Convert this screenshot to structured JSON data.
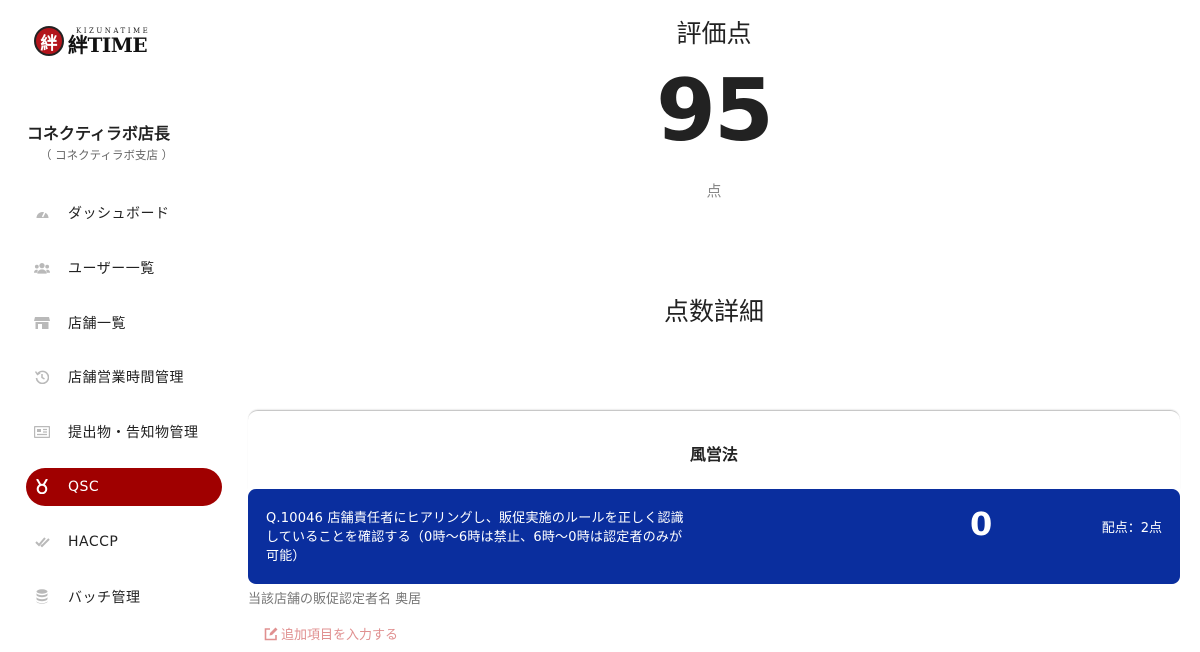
{
  "logo": {
    "mark": "絆",
    "small": "KIZUNATIME",
    "big": "絆TIME"
  },
  "user": {
    "name": "コネクティラボ店長",
    "store": "（ コネクティラボ支店 ）"
  },
  "nav": [
    {
      "label": "ダッシュボード",
      "icon": "dashboard-icon"
    },
    {
      "label": "ユーザー一覧",
      "icon": "users-icon"
    },
    {
      "label": "店舗一覧",
      "icon": "store-icon"
    },
    {
      "label": "店舗営業時間管理",
      "icon": "history-icon"
    },
    {
      "label": "提出物・告知物管理",
      "icon": "newspaper-icon"
    },
    {
      "label": "QSC",
      "icon": "medal-icon"
    },
    {
      "label": "HACCP",
      "icon": "check-double-icon"
    },
    {
      "label": "バッチ管理",
      "icon": "database-icon"
    }
  ],
  "main": {
    "score_title": "評価点",
    "score_value": "95",
    "score_unit": "点",
    "detail_title": "点数詳細",
    "section_title": "風営法",
    "question": {
      "text": "Q.10046 店舗責任者にヒアリングし、販促実施のルールを正しく認識していることを確認する（0時〜6時は禁止、6時〜0時は認定者のみが可能）",
      "score": "0",
      "points": "配点：2点"
    },
    "note": "当該店舗の販促認定者名 奥居",
    "add_link": "追加項目を入力する"
  },
  "colors": {
    "accent": "#a00000",
    "question_bg": "#0a2e9e",
    "link": "#e09090"
  }
}
